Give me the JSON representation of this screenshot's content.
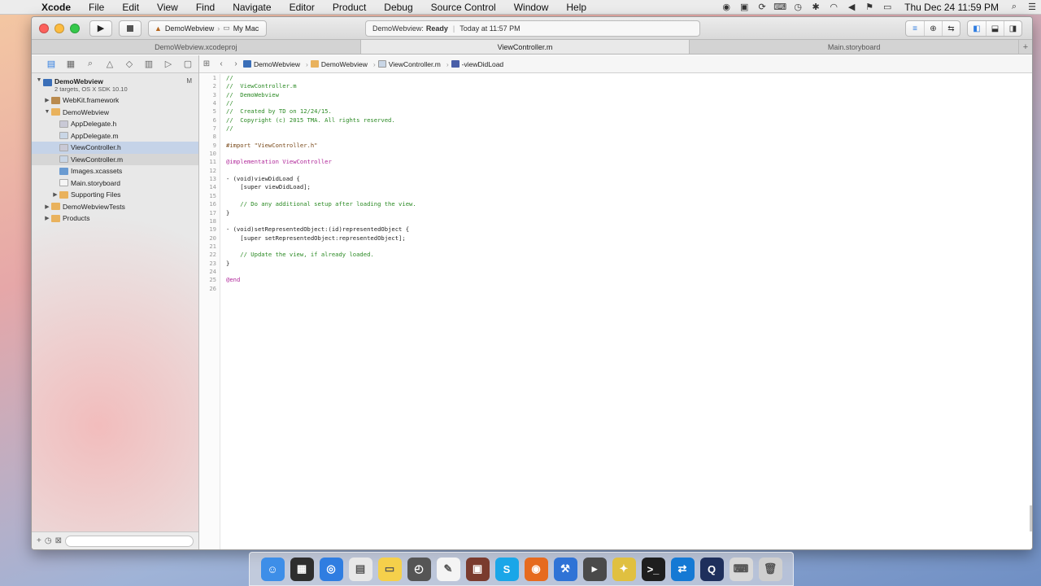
{
  "menubar": {
    "app": "Xcode",
    "items": [
      "File",
      "Edit",
      "View",
      "Find",
      "Navigate",
      "Editor",
      "Product",
      "Debug",
      "Source Control",
      "Window",
      "Help"
    ],
    "clock": "Thu Dec 24  11:59 PM"
  },
  "toolbar": {
    "scheme": "DemoWebview",
    "destination": "My Mac",
    "activity_project": "DemoWebview:",
    "activity_status": "Ready",
    "activity_time": "Today at 11:57 PM"
  },
  "tabs": [
    "DemoWebview.xcodeproj",
    "ViewController.m",
    "Main.storyboard"
  ],
  "navigator": {
    "project": {
      "name": "DemoWebview",
      "subtitle": "2 targets, OS X SDK 10.10",
      "badge": "M"
    },
    "items": [
      {
        "label": "WebKit.framework",
        "icon": "frame",
        "level": 1,
        "disclosure": "▶"
      },
      {
        "label": "DemoWebview",
        "icon": "folder",
        "level": 1,
        "disclosure": "▼"
      },
      {
        "label": "AppDelegate.h",
        "icon": "hfile",
        "level": 2,
        "disclosure": ""
      },
      {
        "label": "AppDelegate.m",
        "icon": "mfile",
        "level": 2,
        "disclosure": ""
      },
      {
        "label": "ViewController.h",
        "icon": "hfile",
        "level": 2,
        "disclosure": ""
      },
      {
        "label": "ViewController.m",
        "icon": "mfile",
        "level": 2,
        "disclosure": ""
      },
      {
        "label": "Images.xcassets",
        "icon": "assets",
        "level": 2,
        "disclosure": ""
      },
      {
        "label": "Main.storyboard",
        "icon": "story",
        "level": 2,
        "disclosure": ""
      },
      {
        "label": "Supporting Files",
        "icon": "folder",
        "level": 2,
        "disclosure": "▶"
      },
      {
        "label": "DemoWebviewTests",
        "icon": "folder",
        "level": 1,
        "disclosure": "▶"
      },
      {
        "label": "Products",
        "icon": "folder",
        "level": 1,
        "disclosure": "▶"
      }
    ]
  },
  "jumpbar": {
    "crumbs": [
      "DemoWebview",
      "DemoWebview",
      "ViewController.m",
      "-viewDidLoad"
    ]
  },
  "code": [
    "//",
    "//  ViewController.m",
    "//  DemoWebview",
    "//",
    "//  Created by TD on 12/24/15.",
    "//  Copyright (c) 2015 TMA. All rights reserved.",
    "//",
    "",
    "#import \"ViewController.h\"",
    "",
    "@implementation ViewController",
    "",
    "- (void)viewDidLoad {",
    "    [super viewDidLoad];",
    "",
    "    // Do any additional setup after loading the view.",
    "}",
    "",
    "- (void)setRepresentedObject:(id)representedObject {",
    "    [super setRepresentedObject:representedObject];",
    "",
    "    // Update the view, if already loaded.",
    "}",
    "",
    "@end",
    ""
  ],
  "dock": [
    "finder-icon",
    "dashboard-icon",
    "safari-icon",
    "preview-icon",
    "stickies-icon",
    "time-machine-icon",
    "textedit-icon",
    "photo-booth-icon",
    "skype-icon",
    "firefox-icon",
    "xcode-icon",
    "sublime-icon",
    "tools-icon",
    "terminal-icon",
    "teamviewer-icon",
    "quicktime-icon",
    "keyboard-icon",
    "trash-icon"
  ]
}
